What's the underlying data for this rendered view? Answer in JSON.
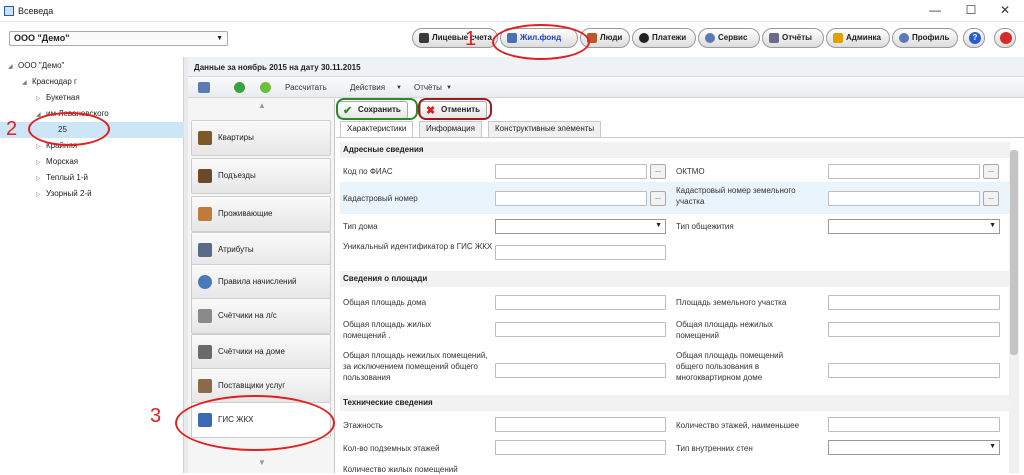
{
  "window": {
    "title": "Всеведа",
    "controls": [
      "—",
      "☐",
      "✕"
    ]
  },
  "org_select": {
    "value": "ООО \"Демо\""
  },
  "toolbar": [
    {
      "label": "Лицевые счета",
      "icon": "book-icon",
      "color": "#3a3a3a"
    },
    {
      "label": "Жил.фонд",
      "icon": "building-icon",
      "color": "#4a6fb5",
      "active": true
    },
    {
      "label": "Люди",
      "icon": "people-icon",
      "color": "#b85a2a"
    },
    {
      "label": "Платежи",
      "icon": "payment-icon",
      "color": "#222222"
    },
    {
      "label": "Сервис",
      "icon": "gear-icon",
      "color": "#5a7ab5"
    },
    {
      "label": "Отчёты",
      "icon": "report-icon",
      "color": "#6a6a8a"
    },
    {
      "label": "Админка",
      "icon": "warning-icon",
      "color": "#e0a000"
    },
    {
      "label": "Профиль",
      "icon": "profile-icon",
      "color": "#5a7ab5"
    }
  ],
  "tree": {
    "root": "ООО \"Демо\"",
    "city": "Краснодар г",
    "streets": [
      "Букетная",
      "им Левановского",
      "Крайняя",
      "Морская",
      "Теплый 1-й",
      "Узорный 2-й"
    ],
    "selected_house": "25"
  },
  "main_header": "Данные за ноябрь 2015 на дату 30.11.2015",
  "action_bar": {
    "calc": "Рассчитать",
    "actions": "Действия",
    "reports": "Отчёты"
  },
  "left_nav": [
    "Квартиры",
    "Подъезды",
    "Проживающие",
    "Атрибуты",
    "Правила начислений",
    "Счётчики на л/с",
    "Счётчики на доме",
    "Поставщики услуг",
    "ГИС ЖКХ"
  ],
  "form_buttons": {
    "save": "Сохранить",
    "cancel": "Отменить"
  },
  "tabs": [
    "Характеристики",
    "Информация",
    "Конструктивные элементы"
  ],
  "sections": {
    "address": "Адресные сведения",
    "area": "Сведения о площади",
    "tech": "Технические сведения"
  },
  "fields": {
    "fias": "Код по ФИАС",
    "oktmo": "ОКТМО",
    "cadastral": "Кадастровый номер",
    "cadastral_land": "Кадастровый номер земельного участка",
    "house_type": "Тип дома",
    "dorm_type": "Тип общежития",
    "gis_id": "Уникальный идентификатор в ГИС ЖКХ",
    "total_area": "Общая площадь дома",
    "land_area": "Площадь земельного участка",
    "living_area": "Общая площадь жилых помещений .",
    "nonliving_area": "Общая площадь нежилых помещений",
    "nonliving_excl": "Общая площадь нежилых помещений, за исключением помещений общего пользования",
    "common_area": "Общая площадь помещений общего пользования в многоквартирном доме",
    "floors": "Этажность",
    "floors_min": "Количество этажей, наименьшее",
    "underground": "Кол-во подземных этажей",
    "wall_type": "Тип внутренних стен",
    "flats_count": "Количество жилых помещений"
  },
  "annotations": [
    "1",
    "2",
    "3"
  ]
}
